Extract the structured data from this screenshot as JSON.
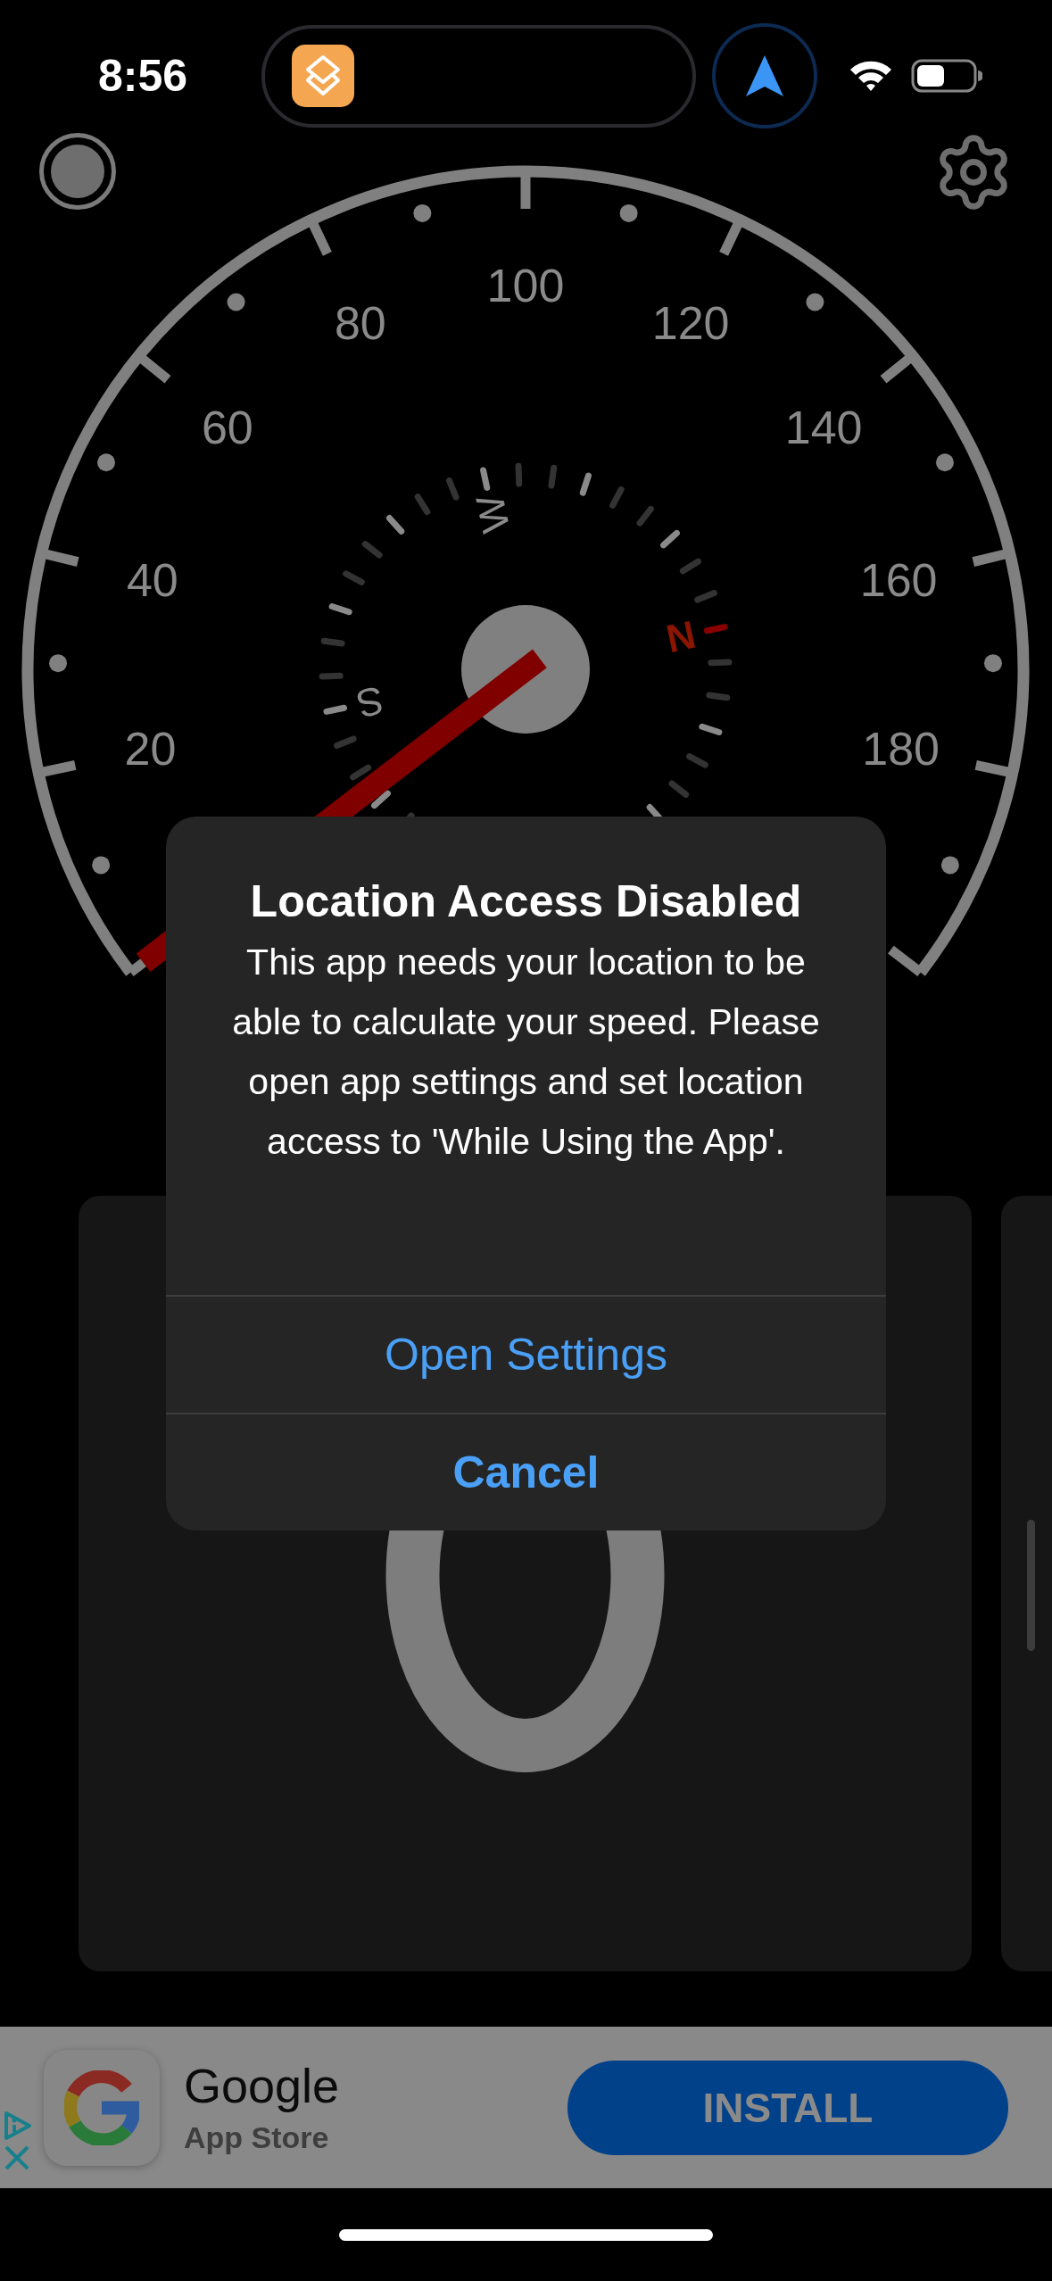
{
  "status_bar": {
    "time": "8:56"
  },
  "gauge": {
    "speed_labels": [
      "20",
      "40",
      "60",
      "80",
      "100",
      "120",
      "140",
      "160",
      "180"
    ],
    "compass": [
      {
        "label": "W",
        "kind": "west"
      },
      {
        "label": "N",
        "kind": "north"
      },
      {
        "label": "S",
        "kind": "south"
      }
    ]
  },
  "dialog": {
    "title": "Location Access Disabled",
    "message": "This app needs your location to be able to calculate your speed. Please open app settings and set location access to 'While Using the App'.",
    "buttons": [
      {
        "label": "Open Settings",
        "kind": "default"
      },
      {
        "label": "Cancel",
        "kind": "cancel"
      }
    ]
  },
  "ad": {
    "title": "Google",
    "subtitle": "App Store",
    "button": "INSTALL"
  }
}
